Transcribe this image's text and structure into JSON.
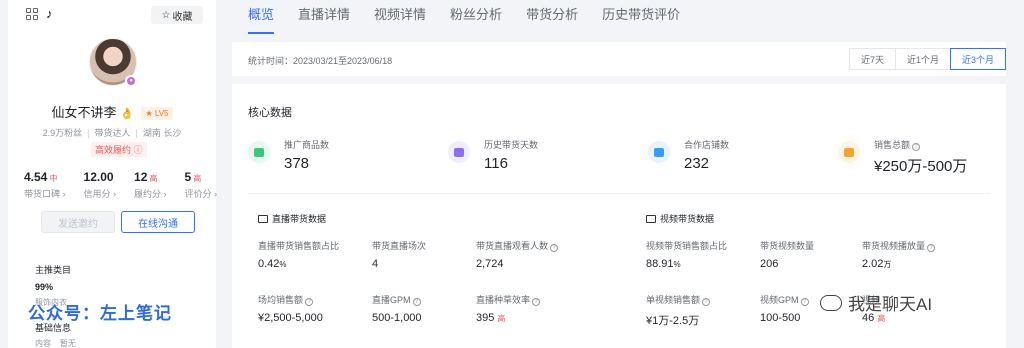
{
  "profile": {
    "favorite_label": "收藏",
    "name": "仙女不讲李",
    "level": "LV5",
    "fans": "2.9万粉丝",
    "role": "带货达人",
    "location": "湖南 长沙",
    "tag": "高效履约"
  },
  "stats": [
    {
      "value": "4.54",
      "level": "中",
      "label": "带货口碑"
    },
    {
      "value": "12.00",
      "level": "",
      "label": "信用分"
    },
    {
      "value": "12",
      "level": "高",
      "label": "履约分"
    },
    {
      "value": "5",
      "level": "高",
      "label": "评价分"
    }
  ],
  "buttons": {
    "invite": "发送邀约",
    "chat": "在线沟通"
  },
  "sections": {
    "main_category_title": "主推类目",
    "main_category_value": "99%",
    "main_category_sub": "服饰内衣",
    "basic_info_title": "基础信息",
    "content_label": "内容",
    "content_value": "暂无"
  },
  "watermarks": {
    "left": "公众号：左上笔记",
    "right": "我是聊天AI"
  },
  "tabs": [
    "概览",
    "直播详情",
    "视频详情",
    "粉丝分析",
    "带货分析",
    "历史带货评价"
  ],
  "active_tab": 0,
  "date_range": "统计时间：2023/03/21至2023/06/18",
  "range_buttons": [
    "近7天",
    "近1个月",
    "近3个月"
  ],
  "active_range": 2,
  "core_title": "核心数据",
  "core": [
    {
      "label": "推广商品数",
      "value": "378",
      "color": "#3ec77a",
      "bg": "#e9f8ef"
    },
    {
      "label": "历史带货天数",
      "value": "116",
      "color": "#8c6ff0",
      "bg": "#f1edff"
    },
    {
      "label": "合作店铺数",
      "value": "232",
      "color": "#3e9bf2",
      "bg": "#e8f3ff"
    },
    {
      "label": "销售总额",
      "value": "¥250万-500万",
      "color": "#f0a62e",
      "bg": "#fff4e3"
    }
  ],
  "live_title": "直播带货数据",
  "video_title": "视频带货数据",
  "live_metrics": [
    {
      "label": "直播带货销售额占比",
      "value": "0.42",
      "unit": "%"
    },
    {
      "label": "带货直播场次",
      "value": "4"
    },
    {
      "label": "带货直播观看人数",
      "value": "2,724",
      "help": true
    },
    {
      "label": "场均销售额",
      "value": "¥2,500-5,000",
      "help": true
    },
    {
      "label": "直播GPM",
      "value": "500-1,000",
      "help": true
    },
    {
      "label": "直播种草效率",
      "value": "395",
      "level": "高",
      "help": true
    }
  ],
  "video_metrics": [
    {
      "label": "视频带货销售额占比",
      "value": "88.91",
      "unit": "%"
    },
    {
      "label": "带货视频数量",
      "value": "206"
    },
    {
      "label": "带货视频播放量",
      "value": "2.02",
      "unit": "万",
      "help": true
    },
    {
      "label": "单视频销售额",
      "value": "¥1万-2.5万",
      "help": true
    },
    {
      "label": "视频GPM",
      "value": "100-500",
      "help": true
    },
    {
      "label": "视频",
      "value": "46",
      "level": "高"
    }
  ]
}
